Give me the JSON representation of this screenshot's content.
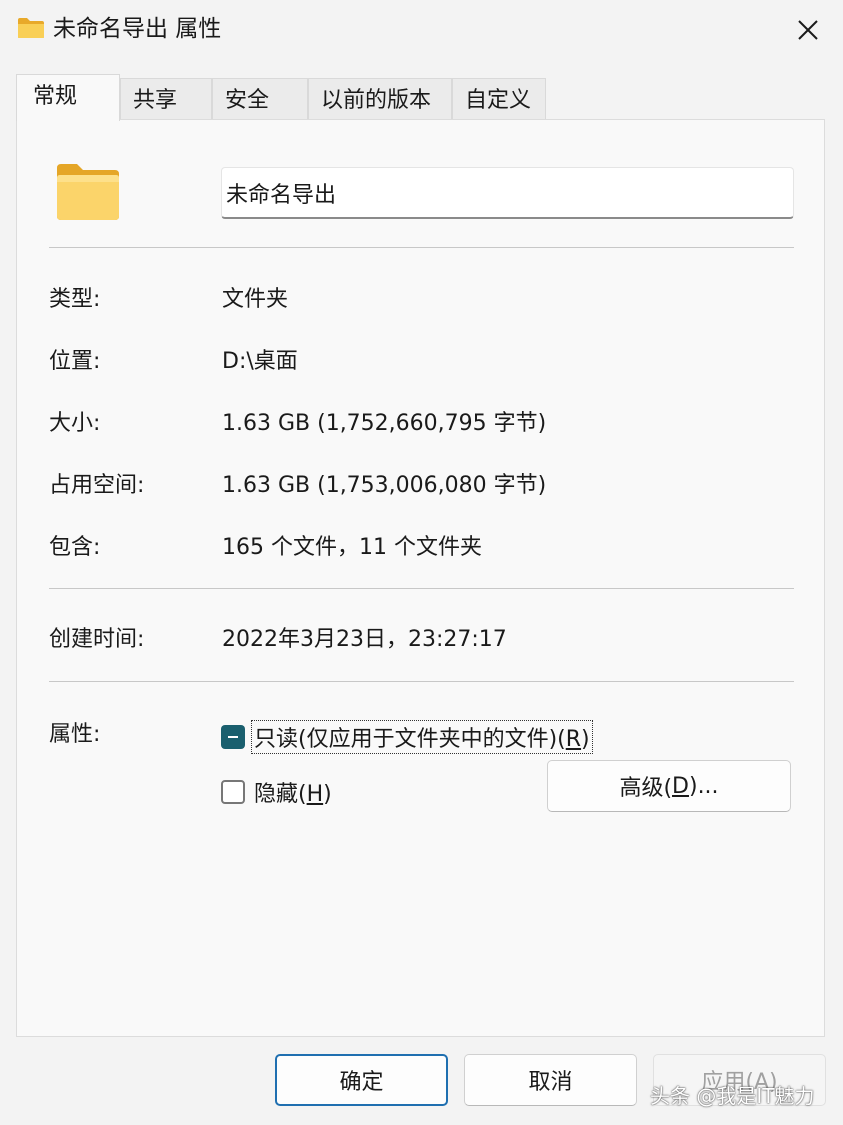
{
  "window": {
    "title": "未命名导出 属性",
    "folder_icon": "folder-icon",
    "close_icon": "close-icon"
  },
  "tabs": [
    {
      "label": "常规",
      "active": true
    },
    {
      "label": "共享",
      "active": false
    },
    {
      "label": "安全",
      "active": false
    },
    {
      "label": "以前的版本",
      "active": false
    },
    {
      "label": "自定义",
      "active": false
    }
  ],
  "general": {
    "name_value": "未命名导出",
    "type_label": "类型:",
    "type_value": "文件夹",
    "location_label": "位置:",
    "location_value": "D:\\桌面",
    "size_label": "大小:",
    "size_value": "1.63 GB (1,752,660,795 字节)",
    "size_on_disk_label": "占用空间:",
    "size_on_disk_value": "1.63 GB (1,753,006,080 字节)",
    "contains_label": "包含:",
    "contains_value": "165 个文件，11 个文件夹",
    "created_label": "创建时间:",
    "created_value": "2022年3月23日，23:27:17",
    "attributes_label": "属性:",
    "readonly_label_main": "只读(仅应用于文件夹中的文件)(",
    "readonly_hotkey": "R",
    "readonly_close": ")",
    "readonly_state": "indeterminate",
    "hidden_label_main": "隐藏(",
    "hidden_hotkey": "H",
    "hidden_close": ")",
    "hidden_state": "unchecked",
    "advanced_main": "高级(",
    "advanced_hotkey": "D",
    "advanced_close": ")..."
  },
  "footer": {
    "ok_label": "确定",
    "cancel_label": "取消",
    "apply_label": "应用(A)"
  },
  "watermark": "头条 @我是IT魅力",
  "colors": {
    "checkbox_accent": "#1a5f6e",
    "folder_yellow": "#f7c948",
    "primary_border": "#1f6fb0"
  }
}
